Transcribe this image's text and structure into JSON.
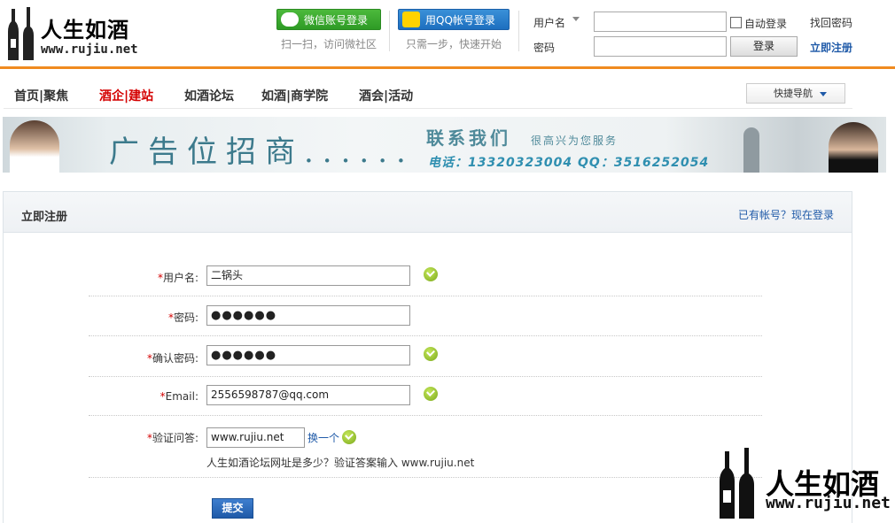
{
  "brand": {
    "name": "人生如酒",
    "url": "www.rujiu.net"
  },
  "social": {
    "wechat_label": "微信账号登录",
    "wechat_sub": "扫一扫，访问微社区",
    "qq_label": "用QQ帐号登录",
    "qq_sub": "只需一步，快速开始"
  },
  "login": {
    "username_label": "用户名",
    "password_label": "密码",
    "username_value": "",
    "password_value": "",
    "auto_login_label": "自动登录",
    "submit_label": "登录",
    "forgot_label": "找回密码",
    "register_label": "立即注册"
  },
  "nav": {
    "items": [
      {
        "label": "首页|聚焦"
      },
      {
        "label": "酒企|建站"
      },
      {
        "label": "如酒论坛"
      },
      {
        "label": "如酒|商学院"
      },
      {
        "label": "酒会|活动"
      }
    ],
    "quick_nav_label": "快捷导航"
  },
  "banner": {
    "headline": "广告位招商......",
    "contact": "联系我们",
    "slogan": "很高兴为您服务",
    "phone": "电话：13320323004  QQ：3516252054"
  },
  "register": {
    "title": "立即注册",
    "login_link": "已有帐号？现在登录",
    "fields": {
      "username": {
        "label": "用户名:",
        "value": "二锅头"
      },
      "password": {
        "label": "密码:",
        "value": "●●●●●●"
      },
      "confirm": {
        "label": "确认密码:",
        "value": "●●●●●●"
      },
      "email": {
        "label": "Email:",
        "value": "2556598787@qq.com"
      },
      "captcha": {
        "label": "验证问答:",
        "value": "www.rujiu.net",
        "swap_label": "换一个",
        "hint": "人生如酒论坛网址是多少？验证答案输入 www.rujiu.net"
      }
    },
    "required_mark": "*",
    "submit_label": "提交"
  },
  "watermark": {
    "name": "人生如酒",
    "url": "www.rujiu.net"
  },
  "colors": {
    "accent": "#f08a1f",
    "link": "#1f5aa8",
    "nav_active": "#d40000",
    "ok": "#7aa81c"
  }
}
